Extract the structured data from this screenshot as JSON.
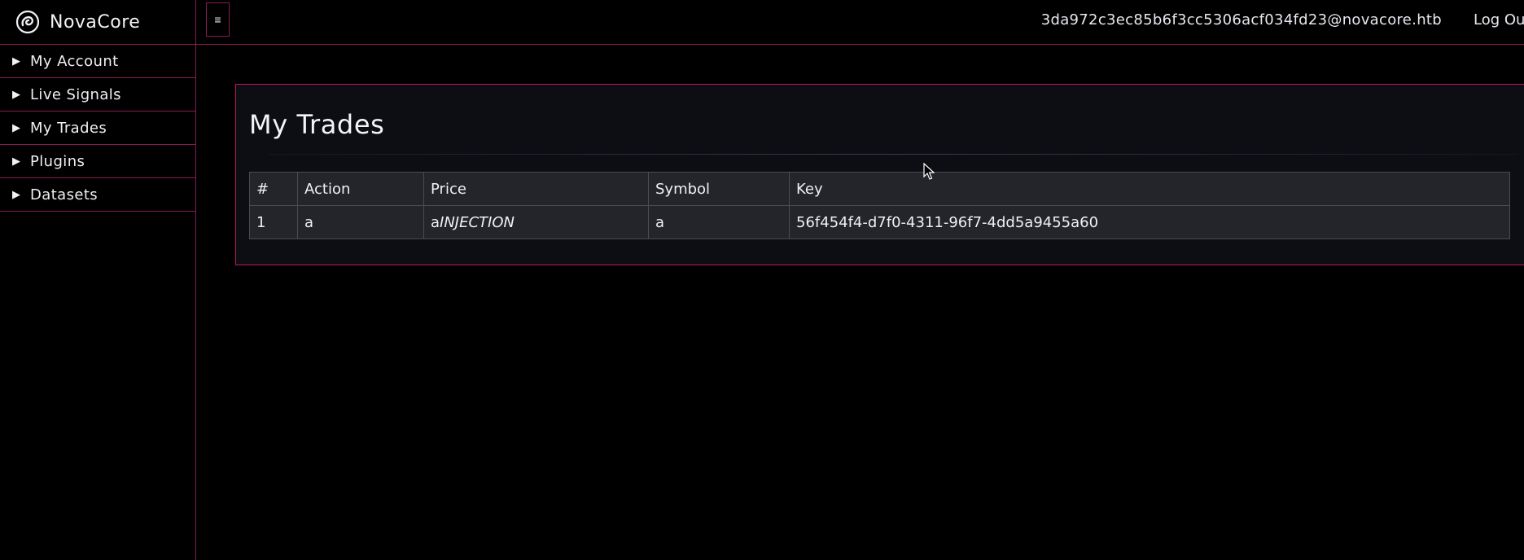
{
  "brand": {
    "name": "NovaCore",
    "logo_icon": "swirl-logo-icon"
  },
  "sidebar": {
    "items": [
      {
        "caret": "▶",
        "label": "My Account"
      },
      {
        "caret": "▶",
        "label": "Live Signals"
      },
      {
        "caret": "▶",
        "label": "My Trades"
      },
      {
        "caret": "▶",
        "label": "Plugins"
      },
      {
        "caret": "▶",
        "label": "Datasets"
      }
    ]
  },
  "topbar": {
    "menu_toggle": "≡",
    "user_email": "3da972c3ec85b6f3cc5306acf034fd23@novacore.htb",
    "logout_label": "Log Out"
  },
  "main": {
    "title": "My Trades",
    "table": {
      "headers": [
        "#",
        "Action",
        "Price",
        "Symbol",
        "Key"
      ],
      "rows": [
        {
          "num": "1",
          "action": "a",
          "price_prefix": "a",
          "price_suffix": "INJECTION",
          "symbol": "a",
          "key": "56f454f4-d7f0-4311-96f7-4dd5a9455a60"
        }
      ]
    }
  },
  "colors": {
    "accent_border": "#c2185b",
    "divider": "#8a1a4f",
    "panel_bg": "#0d0e14",
    "table_bg": "#23252a",
    "page_bg": "#000000"
  }
}
